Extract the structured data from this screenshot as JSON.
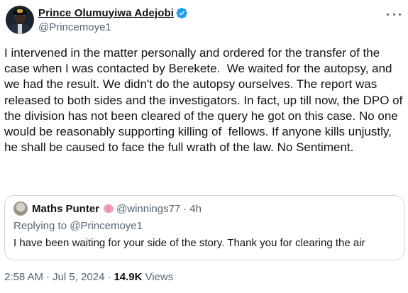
{
  "author": {
    "display_name": "Prince Olumuyiwa Adejobi",
    "handle": "@Princemoye1",
    "verified": true,
    "verified_color": "#1d9bf0"
  },
  "tweet": {
    "text": "I intervened in the matter personally and ordered for the transfer of the case when I was contacted by Berekete.  We waited for the autopsy, and we had the result. We didn't do the autopsy ourselves. The report was released to both sides and the investigators. In fact, up till now, the DPO of the division has not been cleared of the query he got on this case. No one would be reasonably supporting killing of  fellows. If anyone kills unjustly, he shall be caused to face the full wrath of the law. No Sentiment."
  },
  "quote": {
    "display_name": "Maths Punter",
    "handle": "@winnings77",
    "separator": "·",
    "time": "4h",
    "replying_to": "Replying to @Princemoye1",
    "text": "I have been waiting for your side of the story. Thank you for clearing the air"
  },
  "meta": {
    "time": "2:58 AM",
    "separator": "·",
    "date": "Jul 5, 2024",
    "views_count": "14.9K",
    "views_label": "Views"
  },
  "icons": {
    "more": "more-icon",
    "verified": "verified-badge-icon",
    "brain": "brain-emoji-icon"
  }
}
